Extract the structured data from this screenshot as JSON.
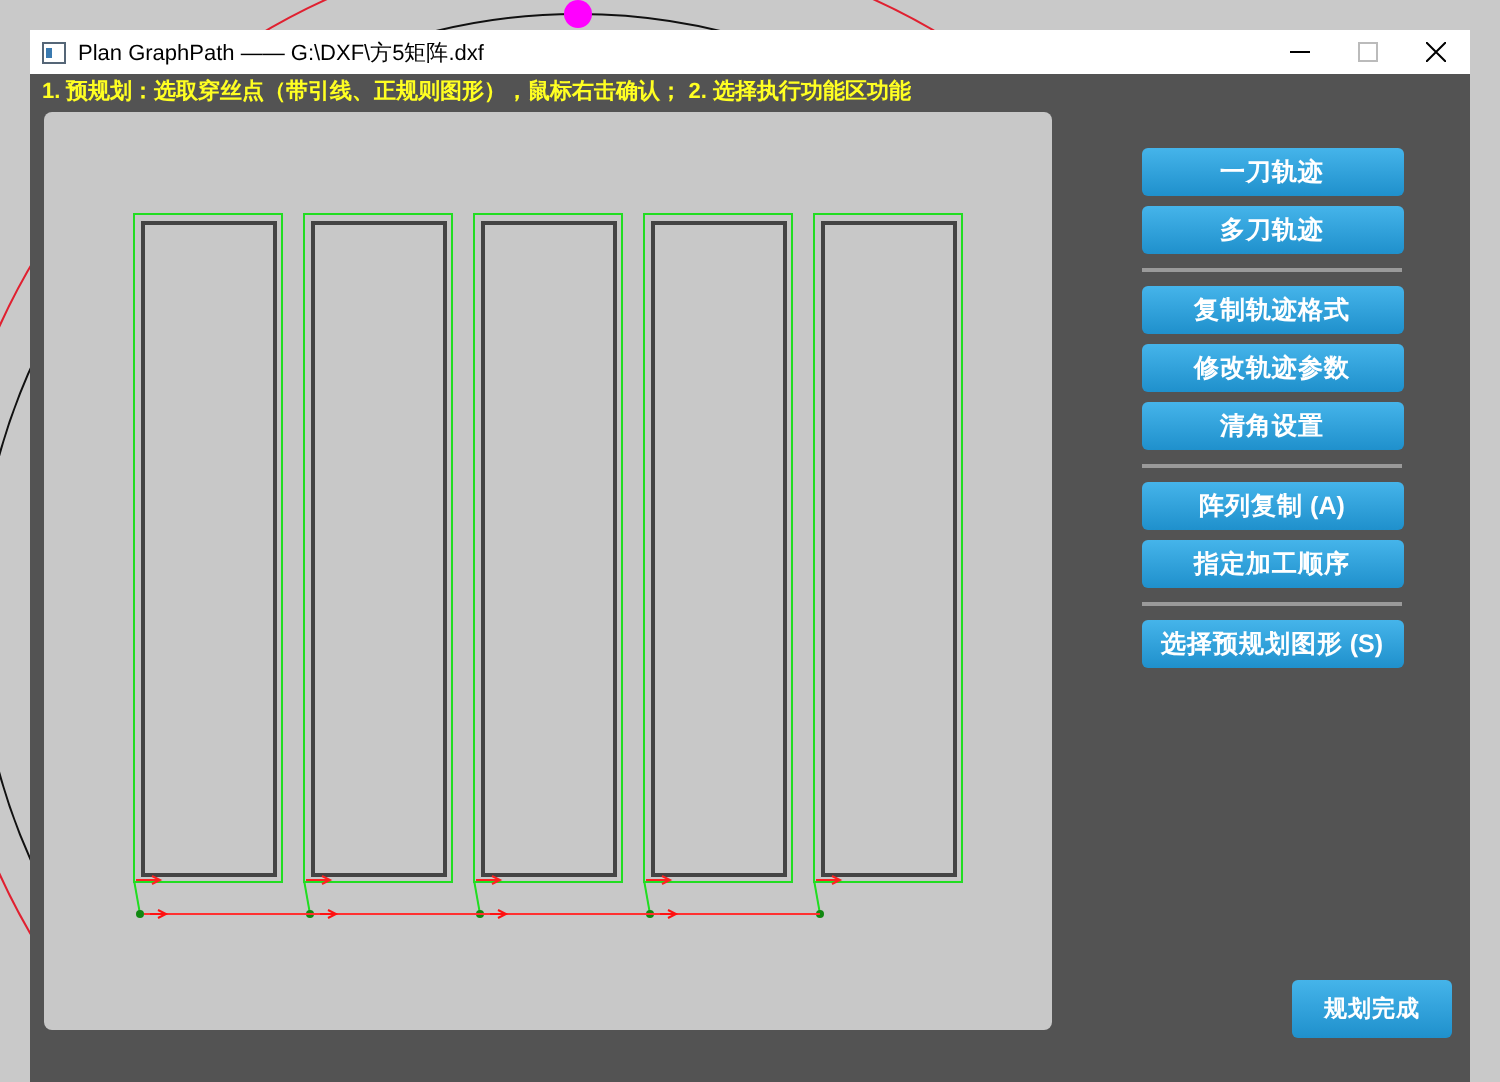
{
  "window": {
    "title": "Plan GraphPath —— G:\\DXF\\方5矩阵.dxf"
  },
  "instruction": "1. 预规划：选取穿丝点（带引线、正规则图形），鼠标右击确认；  2. 选择执行功能区功能",
  "button_groups": [
    [
      "一刀轨迹",
      "多刀轨迹"
    ],
    [
      "复制轨迹格式",
      "修改轨迹参数",
      "清角设置"
    ],
    [
      "阵列复制 (A)",
      "指定加工顺序"
    ],
    [
      "选择预规划图形 (S)"
    ]
  ],
  "finish_button": "规划完成"
}
